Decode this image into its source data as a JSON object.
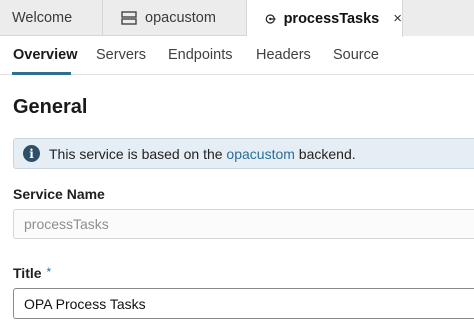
{
  "tabs": {
    "welcome": "Welcome",
    "opacustom": "opacustom",
    "active": "processTasks",
    "close": "×"
  },
  "subtabs": [
    "Overview",
    "Servers",
    "Endpoints",
    "Headers",
    "Source"
  ],
  "section_title": "General",
  "banner": {
    "icon": "info-icon",
    "prefix": "This service is based on the ",
    "link": "opacustom",
    "suffix": " backend."
  },
  "service_name": {
    "label": "Service Name",
    "value": "processTasks"
  },
  "title_field": {
    "label": "Title",
    "required_marker": "*",
    "value": "OPA Process Tasks"
  },
  "colors": {
    "accent": "#2e6f93",
    "link": "#2a6e9c",
    "banner_bg": "#e6eef5"
  }
}
